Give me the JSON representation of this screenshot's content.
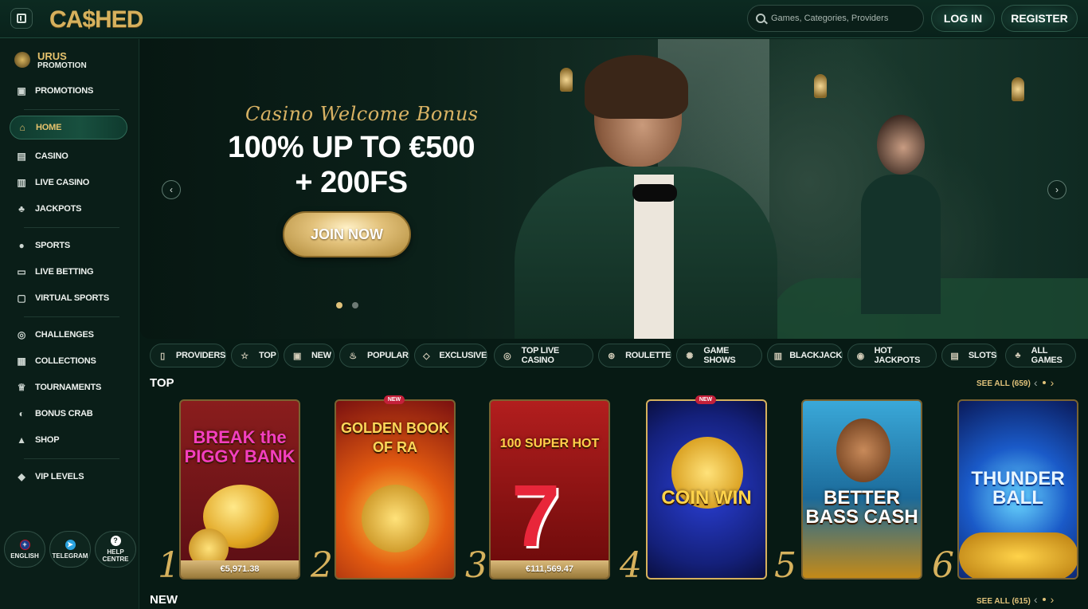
{
  "header": {
    "logo": "CA$HED",
    "search_placeholder": "Games, Categories, Providers",
    "login": "LOG IN",
    "register": "REGISTER"
  },
  "sidebar": {
    "promo_title": "URUS",
    "promo_sub": "PROMOTION",
    "items": [
      {
        "label": "PROMOTIONS",
        "icon": "gift-icon"
      },
      {
        "label": "HOME",
        "icon": "home-icon",
        "active": true
      },
      {
        "label": "CASINO",
        "icon": "slot-machine-icon"
      },
      {
        "label": "LIVE CASINO",
        "icon": "cards-icon"
      },
      {
        "label": "JACKPOTS",
        "icon": "clover-icon"
      },
      {
        "label": "SPORTS",
        "icon": "soccer-ball-icon"
      },
      {
        "label": "LIVE BETTING",
        "icon": "live-icon"
      },
      {
        "label": "VIRTUAL SPORTS",
        "icon": "monitor-icon"
      },
      {
        "label": "CHALLENGES",
        "icon": "medal-icon"
      },
      {
        "label": "COLLECTIONS",
        "icon": "collection-icon"
      },
      {
        "label": "TOURNAMENTS",
        "icon": "trophy-icon"
      },
      {
        "label": "BONUS CRAB",
        "icon": "claw-icon"
      },
      {
        "label": "SHOP",
        "icon": "bag-icon"
      },
      {
        "label": "VIP LEVELS",
        "icon": "diamond-icon"
      }
    ],
    "bottom": [
      {
        "label": "ENGLISH",
        "icon": "uk-flag-icon"
      },
      {
        "label": "TELEGRAM",
        "icon": "telegram-icon"
      },
      {
        "label": "HELP CENTRE",
        "icon": "help-icon"
      }
    ]
  },
  "banner": {
    "subtitle": "Casino Welcome Bonus",
    "headline_1": "100% UP TO €500",
    "headline_2": "+ 200FS",
    "cta": "JOIN NOW",
    "active_slide": 1,
    "total_slides": 2
  },
  "categories": [
    {
      "label": "PROVIDERS",
      "icon": "book-icon"
    },
    {
      "label": "TOP",
      "icon": "star-icon"
    },
    {
      "label": "NEW",
      "icon": "gift-icon"
    },
    {
      "label": "POPULAR",
      "icon": "flame-icon"
    },
    {
      "label": "EXCLUSIVE",
      "icon": "diamond-icon"
    },
    {
      "label": "TOP LIVE CASINO",
      "icon": "medal-icon"
    },
    {
      "label": "ROULETTE",
      "icon": "roulette-icon"
    },
    {
      "label": "GAME SHOWS",
      "icon": "wheel-icon"
    },
    {
      "label": "BLACKJACK",
      "icon": "cards-icon"
    },
    {
      "label": "HOT JACKPOTS",
      "icon": "coin-flame-icon"
    },
    {
      "label": "SLOTS",
      "icon": "slot-machine-icon"
    },
    {
      "label": "ALL GAMES",
      "icon": "clover-icon"
    }
  ],
  "top_section": {
    "title": "TOP",
    "see_all": "SEE ALL (659)",
    "games": [
      {
        "rank": "1",
        "title": "BREAK the PIGGY BANK",
        "jackpot": "€5,971.38",
        "new": false
      },
      {
        "rank": "2",
        "title": "GOLDEN BOOK OF RA",
        "jackpot": "",
        "new": true
      },
      {
        "rank": "3",
        "title": "100 SUPER HOT",
        "jackpot": "€111,569.47",
        "new": false
      },
      {
        "rank": "4",
        "title": "COIN WIN",
        "jackpot": "",
        "new": true
      },
      {
        "rank": "5",
        "title": "BETTER BASS CASH",
        "jackpot": "",
        "new": false
      },
      {
        "rank": "6",
        "title": "THUNDER BALL",
        "jackpot": "",
        "new": false
      }
    ],
    "new_badge": "NEW"
  },
  "new_section": {
    "title": "NEW",
    "see_all": "SEE ALL (615)"
  }
}
